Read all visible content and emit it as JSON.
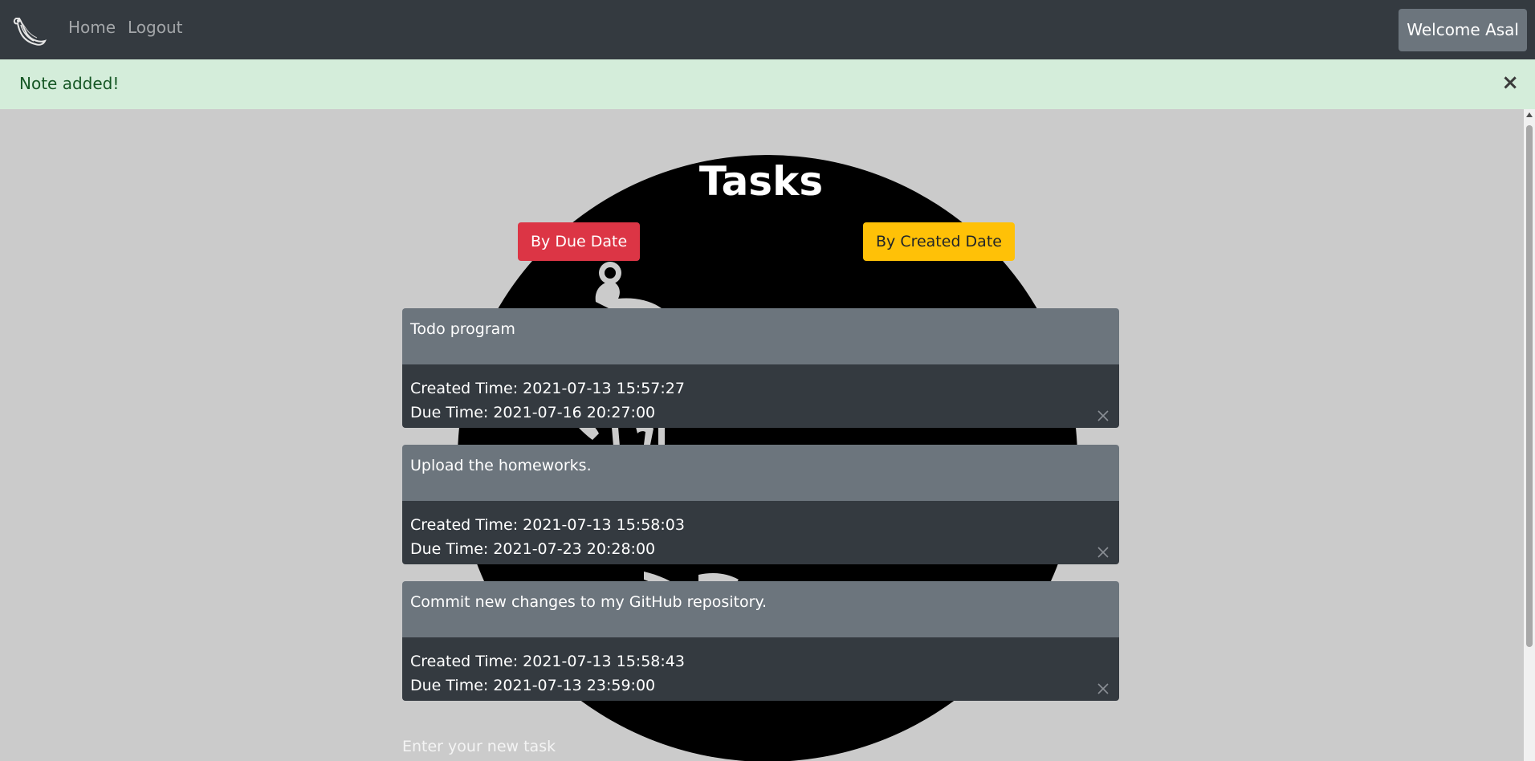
{
  "navbar": {
    "logo_icon": "flask-logo-icon",
    "links": [
      {
        "label": "Home"
      },
      {
        "label": "Logout"
      }
    ],
    "welcome_label": "Welcome Asal"
  },
  "alert": {
    "message": "Note added!",
    "close_glyph": "×"
  },
  "main": {
    "title": "Tasks",
    "sort_buttons": {
      "by_due": "By Due Date",
      "by_created": "By Created Date"
    },
    "tasks": [
      {
        "title": "Todo program",
        "created": "Created Time: 2021-07-13 15:57:27",
        "due": "Due Time: 2021-07-16 20:27:00"
      },
      {
        "title": "Upload the homeworks.",
        "created": "Created Time: 2021-07-13 15:58:03",
        "due": "Due Time: 2021-07-23 20:28:00"
      },
      {
        "title": "Commit new changes to my GitHub repository.",
        "created": "Created Time: 2021-07-13 15:58:43",
        "due": "Due Time: 2021-07-13 23:59:00"
      }
    ],
    "new_task": {
      "placeholder": "Enter your new task",
      "value": ""
    }
  },
  "colors": {
    "navbar": "#343a40",
    "alert_bg": "#d4edda",
    "alert_text": "#155724",
    "page_bg": "#cbcbcb",
    "danger": "#dc3545",
    "warning": "#ffc107",
    "secondary": "#6c757d",
    "dark": "#343a40"
  }
}
